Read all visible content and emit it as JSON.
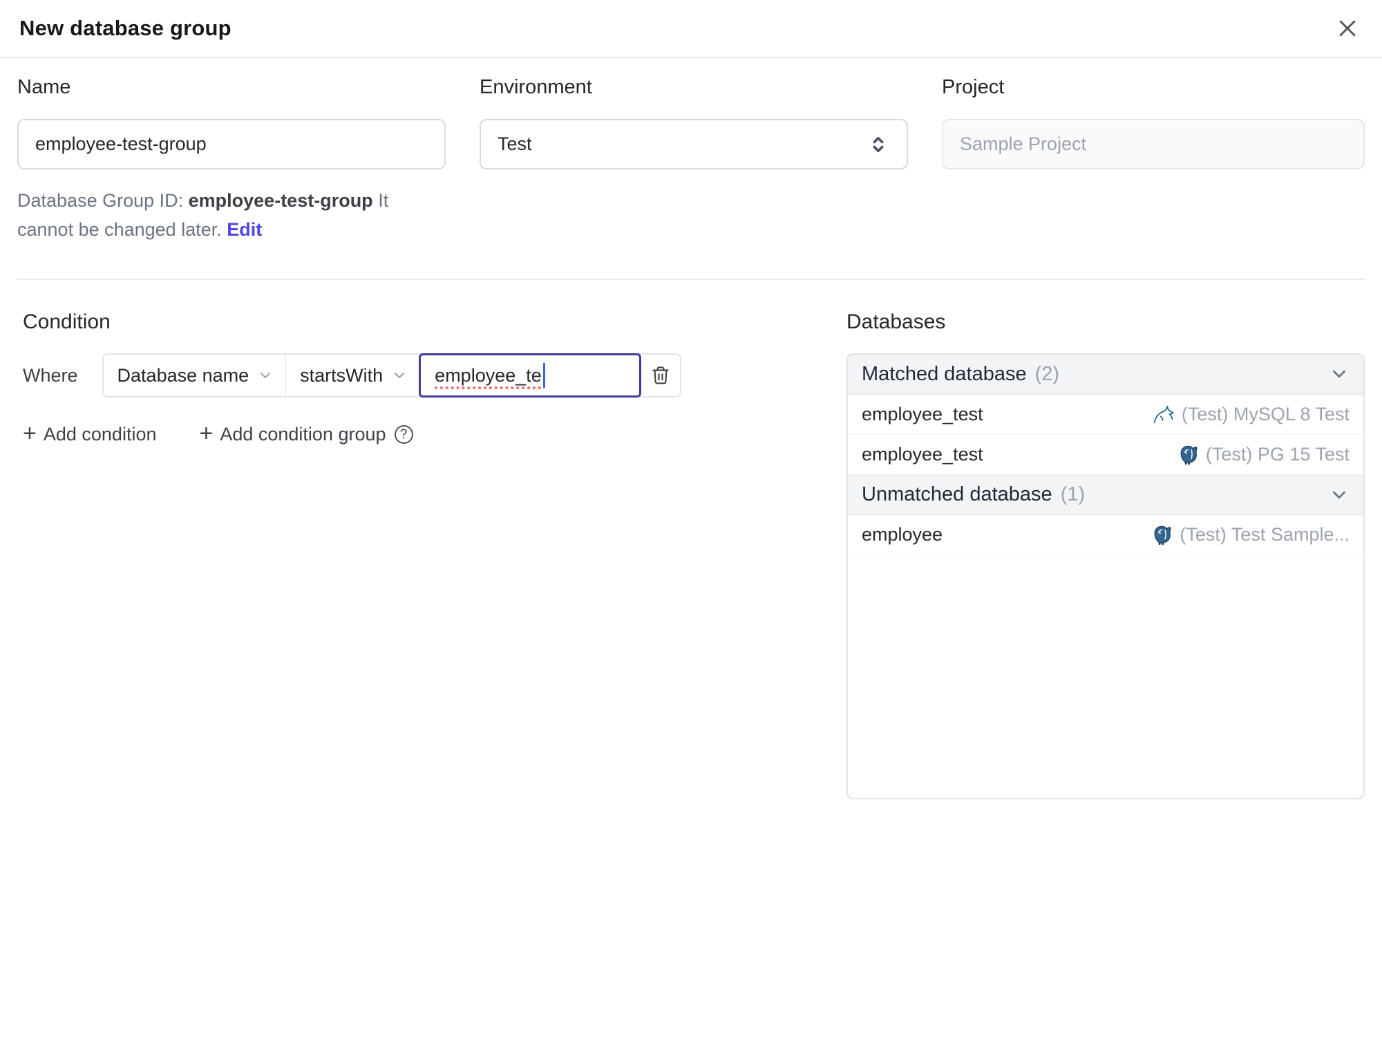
{
  "dialog": {
    "title": "New database group"
  },
  "form": {
    "name": {
      "label": "Name",
      "value": "employee-test-group"
    },
    "environment": {
      "label": "Environment",
      "value": "Test"
    },
    "project": {
      "label": "Project",
      "value": "Sample Project"
    },
    "id_hint": {
      "prefix": "Database Group ID: ",
      "id": "employee-test-group",
      "suffix": " It cannot be changed later. ",
      "edit_label": "Edit"
    }
  },
  "condition": {
    "heading": "Condition",
    "where_label": "Where",
    "field": "Database name",
    "operator": "startsWith",
    "value": "employee_te",
    "add_condition_label": "Add condition",
    "add_condition_group_label": "Add condition group"
  },
  "databases": {
    "heading": "Databases",
    "groups": [
      {
        "title": "Matched database",
        "count": "(2)",
        "rows": [
          {
            "name": "employee_test",
            "engine": "mysql",
            "instance": "(Test) MySQL 8 Test"
          },
          {
            "name": "employee_test",
            "engine": "postgres",
            "instance": "(Test) PG 15 Test"
          }
        ]
      },
      {
        "title": "Unmatched database",
        "count": "(1)",
        "rows": [
          {
            "name": "employee",
            "engine": "postgres",
            "instance": "(Test) Test Sample..."
          }
        ]
      }
    ]
  },
  "icons": {
    "plus": "+",
    "question": "?"
  },
  "colors": {
    "accent": "#4f46e5",
    "focus_border": "#3f3d99",
    "spellcheck_red": "#ee6b5e",
    "mysql_icon": "#00618a",
    "postgres_icon": "#336791",
    "header_bg": "#f3f4f6"
  }
}
